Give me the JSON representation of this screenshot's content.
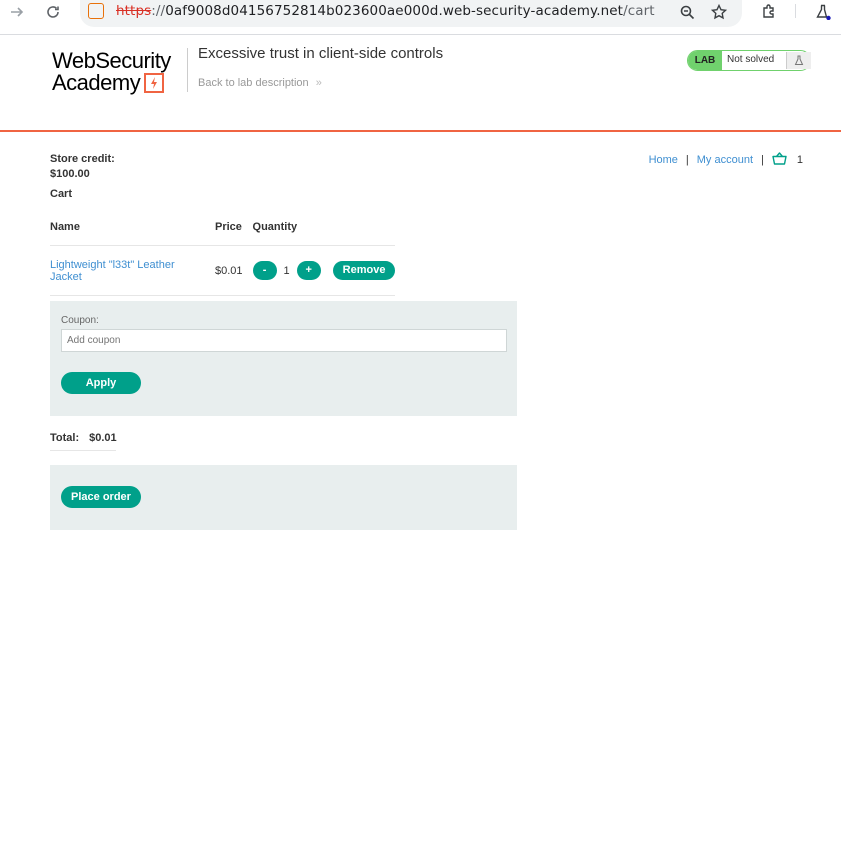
{
  "browser": {
    "url_scheme": "https",
    "url_sep": "://",
    "url_host": "0af9008d04156752814b023600ae000d.web-security-academy.net",
    "url_path": "/cart"
  },
  "header": {
    "logo_line1": "WebSecurity",
    "logo_line2": "Academy",
    "lab_title": "Excessive trust in client-side controls",
    "back_link": "Back to lab description",
    "badge_lab": "LAB",
    "badge_status": "Not solved"
  },
  "nav": {
    "home": "Home",
    "sep": "|",
    "my_account": "My account",
    "cart_count": "1"
  },
  "store": {
    "credit_label": "Store credit:",
    "credit_value": "$100.00"
  },
  "cart": {
    "heading": "Cart",
    "columns": [
      "Name",
      "Price",
      "Quantity"
    ],
    "rows": [
      {
        "name": "Lightweight \"l33t\" Leather Jacket",
        "price": "$0.01",
        "qty": "1",
        "minus": "-",
        "plus": "+",
        "remove": "Remove"
      }
    ]
  },
  "coupon": {
    "label": "Coupon:",
    "placeholder": "Add coupon",
    "apply": "Apply"
  },
  "total": {
    "label": "Total:",
    "value": "$0.01"
  },
  "order": {
    "place_order": "Place order"
  },
  "colors": {
    "accent": "#00a08a",
    "rule": "#f06442",
    "badge": "#70d16d",
    "link": "#3f8fd1"
  }
}
